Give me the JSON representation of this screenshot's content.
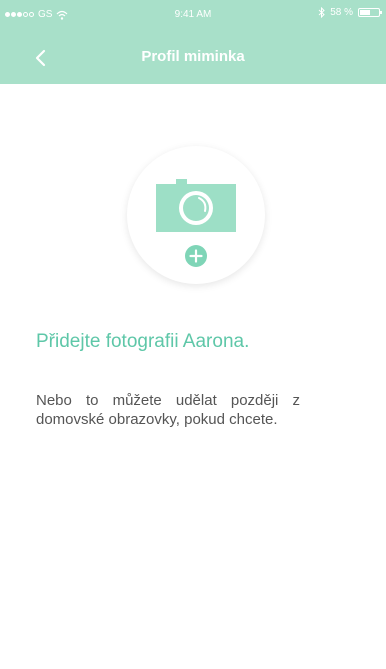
{
  "status_bar": {
    "carrier": "GS",
    "time": "9:41 AM",
    "battery_text": "58 %",
    "battery_level": 0.58,
    "icons": [
      "signal-dots-icon",
      "wifi-icon",
      "bluetooth-icon",
      "battery-icon"
    ]
  },
  "nav": {
    "title": "Profil miminka",
    "back_icon": "chevron-left-icon"
  },
  "photo": {
    "camera_icon": "camera-icon",
    "add_icon": "plus-circle-icon"
  },
  "content": {
    "heading": "Přidejte fotografii Aarona.",
    "description": "Nebo to můžete udělat později z domovské obrazovky, pokud chcete."
  },
  "colors": {
    "header_bg": "#a8e0c9",
    "accent": "#5ec7a8",
    "camera": "#9ddfc6",
    "text": "#555555"
  }
}
